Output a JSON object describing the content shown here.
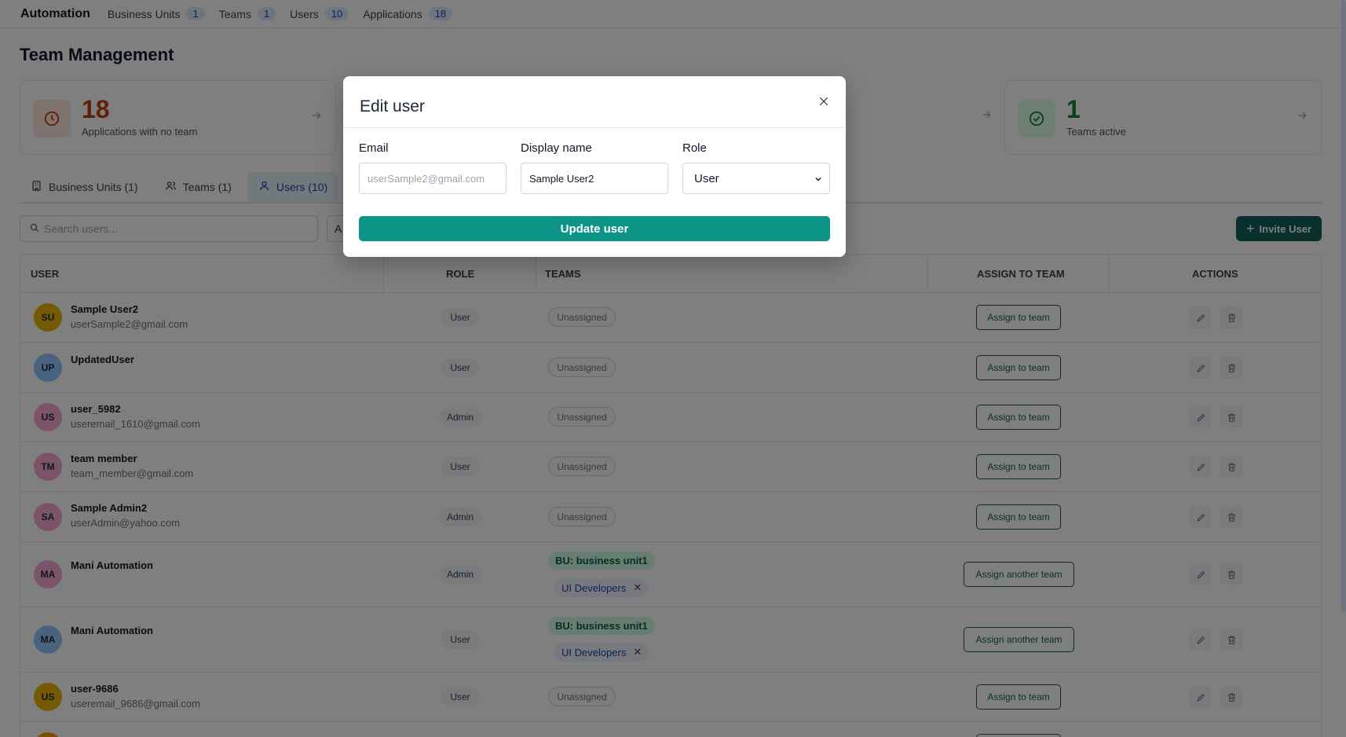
{
  "nav": {
    "brand": "Automation",
    "links": [
      {
        "label": "Business Units",
        "count": "1"
      },
      {
        "label": "Teams",
        "count": "1"
      },
      {
        "label": "Users",
        "count": "10"
      },
      {
        "label": "Applications",
        "count": "18"
      }
    ]
  },
  "page": {
    "title": "Team Management"
  },
  "stats": [
    {
      "value": "18",
      "label": "Applications with no team",
      "icon": "clock-icon",
      "color": "#c2410c"
    },
    {
      "value": "1",
      "label": "Teams active",
      "icon": "check-circle-icon",
      "color": "#15803d"
    }
  ],
  "tabs": [
    {
      "label": "Business Units (1)",
      "icon": "building-icon"
    },
    {
      "label": "Teams (1)",
      "icon": "users-icon"
    },
    {
      "label": "Users (10)",
      "icon": "user-icon"
    }
  ],
  "search": {
    "placeholder": "Search users..."
  },
  "filter": {
    "value": "A"
  },
  "invite_button": "Invite User",
  "table": {
    "headers": [
      "USER",
      "ROLE",
      "TEAMS",
      "ASSIGN TO TEAM",
      "ACTIONS"
    ],
    "rows": [
      {
        "initials": "SU",
        "name": "Sample User2",
        "email": "userSample2@gmail.com",
        "role": "User",
        "teams": "Unassigned",
        "assign": "Assign to team",
        "avatar_color": "#eab308"
      },
      {
        "initials": "UP",
        "name": "UpdatedUser",
        "email": "",
        "role": "User",
        "teams": "Unassigned",
        "assign": "Assign to team",
        "avatar_color": "#93c5fd"
      },
      {
        "initials": "US",
        "name": "user_5982",
        "email": "useremail_1610@gmail.com",
        "role": "Admin",
        "teams": "Unassigned",
        "assign": "Assign to team",
        "avatar_color": "#f9a8d4"
      },
      {
        "initials": "TM",
        "name": "team member",
        "email": "team_member@gmail.com",
        "role": "User",
        "teams": "Unassigned",
        "assign": "Assign to team",
        "avatar_color": "#f9a8d4"
      },
      {
        "initials": "SA",
        "name": "Sample Admin2",
        "email": "userAdmin@yahoo.com",
        "role": "Admin",
        "teams": "Unassigned",
        "assign": "Assign to team",
        "avatar_color": "#f9a8d4"
      },
      {
        "initials": "MA",
        "name": "Mani Automation",
        "email": "",
        "role": "Admin",
        "bu": "BU: business unit1",
        "team": "UI Developers",
        "assign": "Assign another team",
        "avatar_color": "#f9a8d4"
      },
      {
        "initials": "MA",
        "name": "Mani Automation",
        "email": "",
        "role": "User",
        "bu": "BU: business unit1",
        "team": "UI Developers",
        "assign": "Assign another team",
        "avatar_color": "#93c5fd"
      },
      {
        "initials": "US",
        "name": "user-9686",
        "email": "useremail_9686@gmail.com",
        "role": "User",
        "teams": "Unassigned",
        "assign": "Assign to team",
        "avatar_color": "#eab308"
      }
    ]
  },
  "modal": {
    "title": "Edit user",
    "email_label": "Email",
    "email_value": "userSample2@gmail.com",
    "display_name_label": "Display name",
    "display_name_value": "Sample User2",
    "role_label": "Role",
    "role_value": "User",
    "submit": "Update user"
  }
}
